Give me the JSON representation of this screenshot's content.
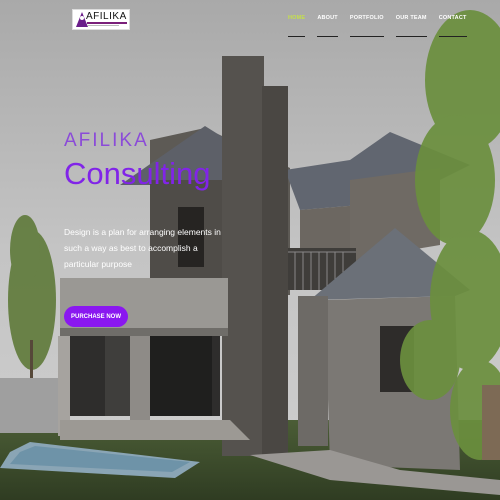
{
  "logo": {
    "text": "AFILIKA"
  },
  "nav": {
    "items": [
      {
        "label": "HOME",
        "active": true
      },
      {
        "label": "ABOUT",
        "active": false
      },
      {
        "label": "PORTFOLIO",
        "active": false
      },
      {
        "label": "OUR TEAM",
        "active": false
      },
      {
        "label": "CONTACT",
        "active": false
      }
    ]
  },
  "hero": {
    "small_title": "AFILIKA",
    "big_title": "Consulting",
    "description": "Design is a plan for arranging elements in such a way as best to accomplish a particular purpose",
    "cta_label": "PURCHASE NOW"
  },
  "colors": {
    "accent": "#8a17f0",
    "nav_active": "#c5e04a",
    "title_purple": "#8124e8"
  }
}
